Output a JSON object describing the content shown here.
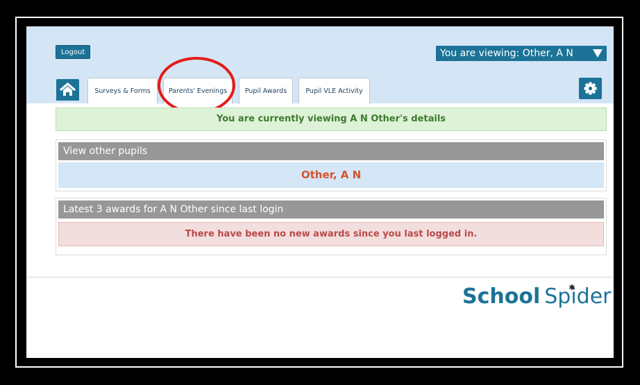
{
  "header": {
    "logout_label": "Logout",
    "viewing_label": "You are viewing: Other, A N"
  },
  "tabs": [
    {
      "label": "Surveys & Forms"
    },
    {
      "label": "Parents' Evenings"
    },
    {
      "label": "Pupil Awards"
    },
    {
      "label": "Pupil VLE Activity"
    }
  ],
  "notice": {
    "text": "You are currently viewing A N Other's details"
  },
  "pupils_panel": {
    "title": "View other pupils",
    "pupil_name": "Other, A N"
  },
  "awards_panel": {
    "title": "Latest 3 awards for A N Other since last login",
    "empty_message": "There have been no new awards since you last logged in."
  },
  "footer": {
    "logo_word1": "School",
    "logo_word2": "Spider"
  },
  "icons": {
    "home": "home-icon",
    "settings": "gear-icon",
    "dropdown": "caret-down-icon"
  },
  "colors": {
    "brand": "#1c7397",
    "header_bg": "#d4e5f6",
    "notice_green": "#def2d8",
    "pupil_name": "#d2552c",
    "error_text": "#b94a48",
    "highlight_circle": "#e41b17"
  }
}
